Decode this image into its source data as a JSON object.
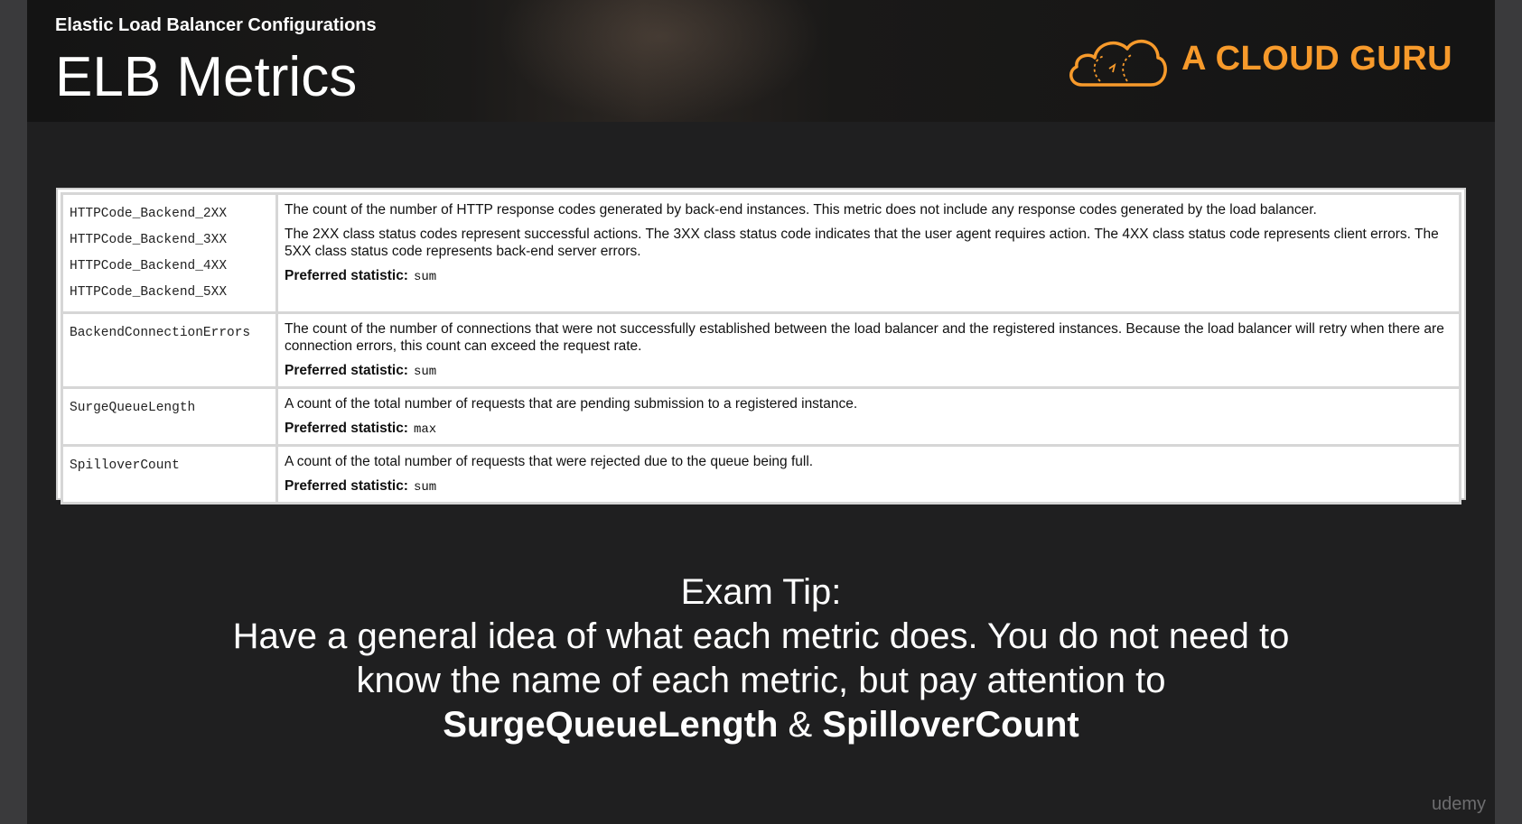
{
  "header": {
    "subtitle": "Elastic Load Balancer Configurations",
    "title": "ELB Metrics",
    "logo_text": "A CLOUD GURU"
  },
  "metrics": [
    {
      "names": [
        "HTTPCode_Backend_2XX",
        "HTTPCode_Backend_3XX",
        "HTTPCode_Backend_4XX",
        "HTTPCode_Backend_5XX"
      ],
      "paragraphs": [
        "The count of the number of HTTP response codes generated by back-end instances. This metric does not include any response codes generated by the load balancer.",
        "The 2XX class status codes represent successful actions. The 3XX class status code indicates that the user agent requires action. The 4XX class status code represents client errors. The 5XX class status code represents back-end server errors."
      ],
      "preferred_label": "Preferred statistic:",
      "preferred_value": "sum"
    },
    {
      "names": [
        "BackendConnectionErrors"
      ],
      "paragraphs": [
        "The count of the number of connections that were not successfully established between the load balancer and the registered instances. Because the load balancer will retry when there are connection errors, this count can exceed the request rate."
      ],
      "preferred_label": "Preferred statistic:",
      "preferred_value": "sum"
    },
    {
      "names": [
        "SurgeQueueLength"
      ],
      "paragraphs": [
        "A count of the total number of requests that are pending submission to a registered instance."
      ],
      "preferred_label": "Preferred statistic:",
      "preferred_value": "max"
    },
    {
      "names": [
        "SpilloverCount"
      ],
      "paragraphs": [
        "A count of the total number of requests that were rejected due to the queue being full."
      ],
      "preferred_label": "Preferred statistic:",
      "preferred_value": "sum"
    }
  ],
  "tip": {
    "heading": "Exam Tip:",
    "line1": "Have a general idea of what each metric does. You do not need to",
    "line2": "know the name of each metric, but pay attention to",
    "bold1": "SurgeQueueLength",
    "amp": " & ",
    "bold2": "SpilloverCount"
  },
  "watermark": "udemy",
  "colors": {
    "accent": "#f79a2b",
    "slide_bg": "#1f1f20",
    "text": "#ffffff"
  },
  "icons": {
    "logo": "cloud-guru-logo-icon"
  }
}
